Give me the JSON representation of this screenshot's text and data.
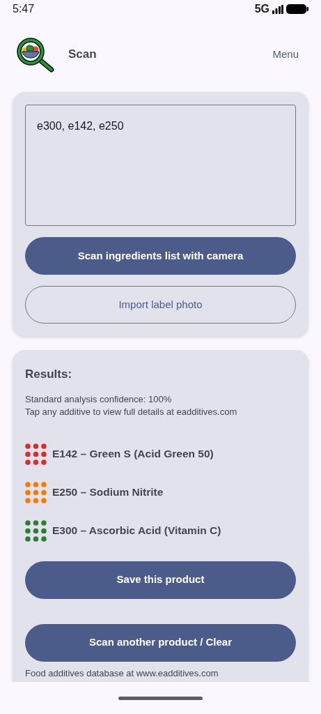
{
  "status_bar": {
    "time": "5:47",
    "network": "5G"
  },
  "app_bar": {
    "title": "Scan",
    "menu": "Menu"
  },
  "input": {
    "value": "e300, e142, e250"
  },
  "scan_buttons": [
    {
      "label": "Scan ingredients list with camera",
      "kind": "filled"
    },
    {
      "label": "Import label photo",
      "kind": "outlined"
    }
  ],
  "results": {
    "heading": "Results:",
    "notes": [
      "Standard analysis confidence: 100%",
      "Tap any additive to view full details at eadditives.com"
    ],
    "additives": [
      {
        "label": "E142 – Green S (Acid Green 50)",
        "color": "#d32f2f"
      },
      {
        "label": "E250 – Sodium Nitrite",
        "color": "#f57c00"
      },
      {
        "label": "E300 – Ascorbic Acid (Vitamin C)",
        "color": "#2e7d32"
      }
    ],
    "buttons": [
      "Save this product",
      "Scan another product / Clear"
    ],
    "footer": "Food additives database at www.eadditives.com"
  }
}
